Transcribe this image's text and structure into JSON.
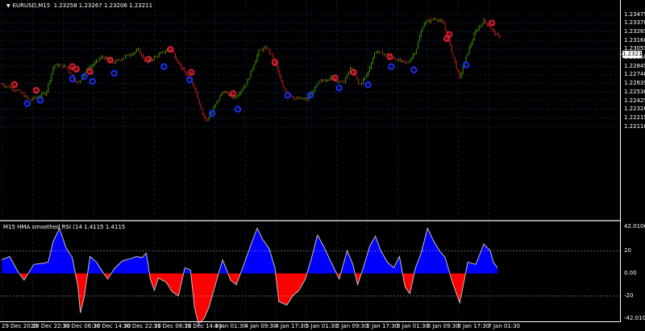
{
  "window": {
    "symbol": "EURUSD,M15",
    "ohlc": "1.23258 1.23267 1.23206 1.23211",
    "current_price": "1.23211"
  },
  "price_axis": {
    "ticks": [
      "1.23475",
      "1.23370",
      "1.23265",
      "1.23160",
      "1.23055",
      "1.22950",
      "1.22845",
      "1.22740",
      "1.22635",
      "1.22530",
      "1.22425",
      "1.22320",
      "1.22215",
      "1.22110"
    ],
    "values": [
      1.23475,
      1.2337,
      1.23265,
      1.2316,
      1.23055,
      1.2295,
      1.22845,
      1.2274,
      1.22635,
      1.2253,
      1.22425,
      1.2232,
      1.22215,
      1.2211
    ]
  },
  "indicator": {
    "title": "M15 HMA smoothed RSI  (14 1.4115 1.4115",
    "ticks": [
      "42.0106",
      "20",
      "0.00",
      "-20",
      "-42.0106"
    ],
    "values": [
      42.0106,
      20,
      0,
      -20,
      -42.0106
    ]
  },
  "time_axis": {
    "labels": [
      "29 Dec 2020",
      "29 Dec 22:30",
      "30 Dec 06:30",
      "30 Dec 14:30",
      "30 Dec 22:30",
      "31 Dec 06:30",
      "31 Dec 14:30",
      "4 Jan 01:30",
      "4 Jan 09:30",
      "4 Jan 17:30",
      "5 Jan 01:30",
      "5 Jan 09:30",
      "5 Jan 17:30",
      "6 Jan 01:30",
      "6 Jan 09:30",
      "6 Jan 17:30",
      "7 Jan 01:30"
    ]
  },
  "chart_data": {
    "type": "line",
    "price_path": [
      [
        0,
        1.22625
      ],
      [
        20,
        1.2255
      ],
      [
        35,
        1.2243
      ],
      [
        55,
        1.2252
      ],
      [
        65,
        1.2286
      ],
      [
        80,
        1.2284
      ],
      [
        95,
        1.2263
      ],
      [
        105,
        1.2279
      ],
      [
        125,
        1.2296
      ],
      [
        140,
        1.2289
      ],
      [
        155,
        1.2297
      ],
      [
        170,
        1.2304
      ],
      [
        180,
        1.2289
      ],
      [
        195,
        1.2298
      ],
      [
        210,
        1.2306
      ],
      [
        225,
        1.2281
      ],
      [
        240,
        1.2259
      ],
      [
        250,
        1.2227
      ],
      [
        255,
        1.2217
      ],
      [
        265,
        1.2236
      ],
      [
        275,
        1.2254
      ],
      [
        290,
        1.2246
      ],
      [
        305,
        1.2264
      ],
      [
        320,
        1.2303
      ],
      [
        330,
        1.2307
      ],
      [
        340,
        1.2291
      ],
      [
        350,
        1.2258
      ],
      [
        365,
        1.2245
      ],
      [
        380,
        1.2244
      ],
      [
        395,
        1.2265
      ],
      [
        410,
        1.2271
      ],
      [
        425,
        1.2264
      ],
      [
        435,
        1.2283
      ],
      [
        445,
        1.2261
      ],
      [
        455,
        1.2275
      ],
      [
        465,
        1.2303
      ],
      [
        480,
        1.2298
      ],
      [
        495,
        1.2291
      ],
      [
        505,
        1.2288
      ],
      [
        515,
        1.2303
      ],
      [
        525,
        1.2337
      ],
      [
        540,
        1.2343
      ],
      [
        550,
        1.2336
      ],
      [
        560,
        1.2302
      ],
      [
        570,
        1.227
      ],
      [
        580,
        1.2302
      ],
      [
        590,
        1.2327
      ],
      [
        600,
        1.234
      ],
      [
        610,
        1.2329
      ],
      [
        617,
        1.2321
      ]
    ],
    "up_signals": [
      [
        32,
        1.2239
      ],
      [
        48,
        1.2243
      ],
      [
        88,
        1.2269
      ],
      [
        103,
        1.2272
      ],
      [
        113,
        1.2266
      ],
      [
        140,
        1.2276
      ],
      [
        202,
        1.2284
      ],
      [
        234,
        1.2268
      ],
      [
        262,
        1.2227
      ],
      [
        294,
        1.2232
      ],
      [
        356,
        1.2249
      ],
      [
        384,
        1.2249
      ],
      [
        420,
        1.2258
      ],
      [
        456,
        1.2262
      ],
      [
        485,
        1.2284
      ],
      [
        513,
        1.228
      ],
      [
        578,
        1.2286
      ]
    ],
    "down_signals": [
      [
        16,
        1.2262
      ],
      [
        43,
        1.2255
      ],
      [
        88,
        1.2284
      ],
      [
        93,
        1.2281
      ],
      [
        110,
        1.2278
      ],
      [
        135,
        1.2292
      ],
      [
        183,
        1.2293
      ],
      [
        210,
        1.2305
      ],
      [
        236,
        1.2277
      ],
      [
        288,
        1.2251
      ],
      [
        340,
        1.2289
      ],
      [
        415,
        1.227
      ],
      [
        438,
        1.2277
      ],
      [
        483,
        1.2296
      ],
      [
        554,
        1.2318
      ],
      [
        557,
        1.2323
      ],
      [
        610,
        1.2337
      ]
    ],
    "rsi_path": [
      [
        0,
        12
      ],
      [
        10,
        15
      ],
      [
        20,
        2
      ],
      [
        28,
        -6
      ],
      [
        40,
        8
      ],
      [
        52,
        9
      ],
      [
        58,
        10
      ],
      [
        64,
        28
      ],
      [
        72,
        40
      ],
      [
        80,
        23
      ],
      [
        88,
        14
      ],
      [
        95,
        -12
      ],
      [
        98,
        -35
      ],
      [
        103,
        -20
      ],
      [
        110,
        15
      ],
      [
        118,
        10
      ],
      [
        125,
        2
      ],
      [
        132,
        -5
      ],
      [
        140,
        4
      ],
      [
        150,
        11
      ],
      [
        160,
        13
      ],
      [
        168,
        15
      ],
      [
        175,
        14
      ],
      [
        180,
        18
      ],
      [
        185,
        -5
      ],
      [
        190,
        -15
      ],
      [
        195,
        -4
      ],
      [
        205,
        -8
      ],
      [
        212,
        -16
      ],
      [
        220,
        -20
      ],
      [
        228,
        5
      ],
      [
        235,
        3
      ],
      [
        240,
        -30
      ],
      [
        245,
        -45
      ],
      [
        252,
        -40
      ],
      [
        258,
        -30
      ],
      [
        262,
        -20
      ],
      [
        270,
        0
      ],
      [
        275,
        12
      ],
      [
        285,
        -6
      ],
      [
        292,
        -10
      ],
      [
        300,
        5
      ],
      [
        310,
        25
      ],
      [
        318,
        40
      ],
      [
        325,
        30
      ],
      [
        333,
        22
      ],
      [
        340,
        5
      ],
      [
        345,
        -25
      ],
      [
        355,
        -28
      ],
      [
        362,
        -20
      ],
      [
        370,
        -15
      ],
      [
        378,
        -5
      ],
      [
        385,
        12
      ],
      [
        393,
        34
      ],
      [
        400,
        25
      ],
      [
        410,
        10
      ],
      [
        420,
        -5
      ],
      [
        430,
        20
      ],
      [
        437,
        8
      ],
      [
        443,
        -10
      ],
      [
        450,
        5
      ],
      [
        458,
        24
      ],
      [
        465,
        33
      ],
      [
        472,
        20
      ],
      [
        480,
        10
      ],
      [
        488,
        5
      ],
      [
        495,
        15
      ],
      [
        502,
        -12
      ],
      [
        508,
        -18
      ],
      [
        515,
        5
      ],
      [
        522,
        18
      ],
      [
        530,
        40
      ],
      [
        538,
        28
      ],
      [
        545,
        20
      ],
      [
        552,
        14
      ],
      [
        560,
        -6
      ],
      [
        565,
        -16
      ],
      [
        570,
        -26
      ],
      [
        574,
        -12
      ],
      [
        580,
        10
      ],
      [
        590,
        8
      ],
      [
        600,
        26
      ],
      [
        608,
        20
      ],
      [
        612,
        10
      ],
      [
        617,
        5
      ]
    ]
  },
  "colors": {
    "background": "#000000",
    "grid": "#1c2a5c",
    "bull_candle": "#3aa000",
    "bear_candle": "#cf1f1f",
    "up_signal": "#1630ff",
    "down_signal": "#e02030",
    "rsi_positive": "#0000ff",
    "rsi_negative": "#ff0000",
    "rsi_line": "#c0c0c0",
    "axis_text": "#ffffff"
  }
}
